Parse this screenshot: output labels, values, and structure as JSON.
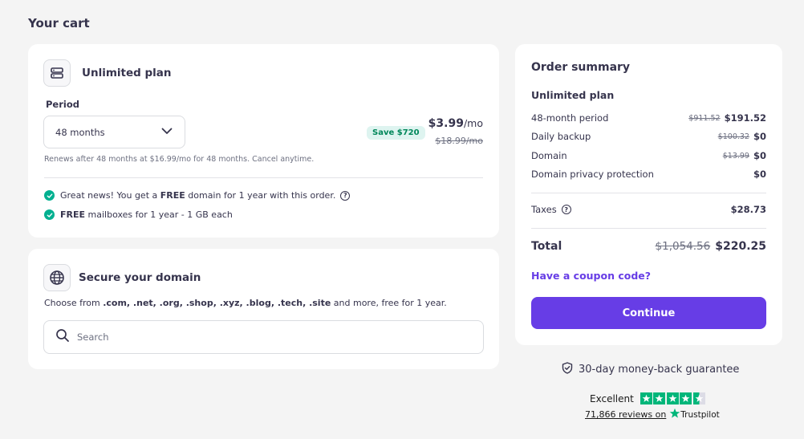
{
  "page": {
    "title": "Your cart"
  },
  "plan_card": {
    "heading": "Unlimited plan",
    "period_label": "Period",
    "period_value": "48 months",
    "save_badge": "Save $720",
    "price": "$3.99",
    "price_suffix": "/mo",
    "old_price": "$18.99/mo",
    "renew_text": "Renews after 48 months at $16.99/mo for 48 months. Cancel anytime.",
    "perks": [
      {
        "prefix": "Great news! You get a ",
        "bold": "FREE",
        "suffix": " domain for 1 year with this order."
      },
      {
        "prefix": "",
        "bold": "FREE",
        "suffix": " mailboxes for 1 year - 1 GB each"
      }
    ]
  },
  "domain_card": {
    "heading": "Secure your domain",
    "desc_prefix": "Choose from ",
    "extensions": ".com, .net, .org, .shop, .xyz, .blog, .tech, .site",
    "desc_suffix": " and more, free for 1 year.",
    "search_placeholder": "Search"
  },
  "summary": {
    "title": "Order summary",
    "plan_name": "Unlimited plan",
    "rows": [
      {
        "label": "48-month period",
        "old": "$911.52",
        "value": "$191.52"
      },
      {
        "label": "Daily backup",
        "old": "$100.32",
        "value": "$0"
      },
      {
        "label": "Domain",
        "old": "$13.99",
        "value": "$0"
      },
      {
        "label": "Domain privacy protection",
        "old": "",
        "value": "$0"
      }
    ],
    "taxes_label": "Taxes",
    "taxes_value": "$28.73",
    "total_label": "Total",
    "total_old": "$1,054.56",
    "total_value": "$220.25",
    "coupon_link": "Have a coupon code?",
    "continue_label": "Continue"
  },
  "guarantee": {
    "text": "30-day money-back guarantee"
  },
  "trustpilot": {
    "rating_text": "Excellent",
    "stars": 4.5,
    "reviews_link": "71,866 reviews on",
    "brand": "Trustpilot"
  },
  "colors": {
    "accent": "#673de6",
    "success": "#00b090",
    "trustpilot_green": "#00b67a",
    "text": "#36344d",
    "muted": "#6d7081"
  }
}
